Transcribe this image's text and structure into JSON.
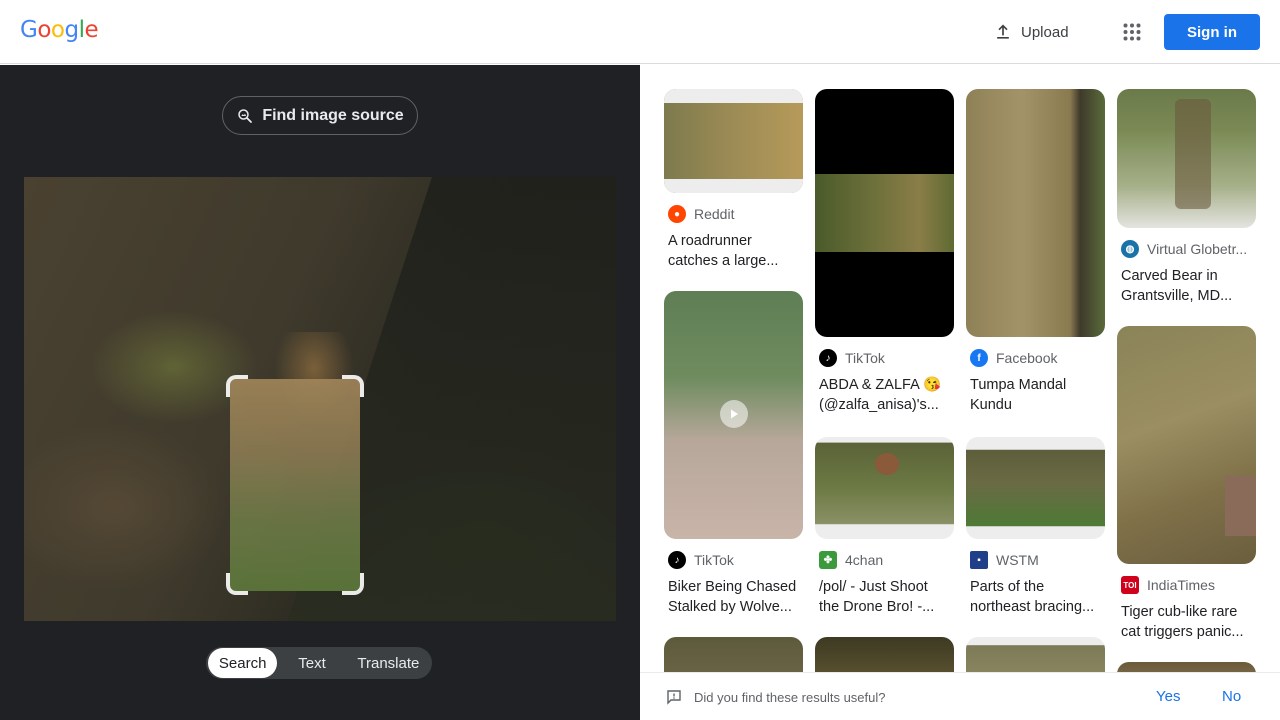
{
  "header": {
    "logo_letters": [
      "G",
      "o",
      "o",
      "g",
      "l",
      "e"
    ],
    "logo_colors": [
      "#4285F4",
      "#EA4335",
      "#FBBC05",
      "#4285F4",
      "#34A853",
      "#EA4335"
    ],
    "upload_label": "Upload",
    "apps_icon": "apps-grid-icon",
    "signin_label": "Sign in"
  },
  "left": {
    "find_source_label": "Find image source",
    "tabs": [
      {
        "label": "Search",
        "active": true
      },
      {
        "label": "Text",
        "active": false
      },
      {
        "label": "Translate",
        "active": false
      }
    ]
  },
  "results": [
    {
      "source": "Reddit",
      "icon": "reddit-icon",
      "icon_color": "#FF4500",
      "title_lines": [
        "A roadrunner",
        "catches a large..."
      ]
    },
    {
      "source": "TikTok",
      "icon": "tiktok-icon",
      "icon_color": "#000000",
      "title_lines": [
        "ABDA & ZALFA 😘",
        "(@zalfa_anisa)'s..."
      ]
    },
    {
      "source": "Facebook",
      "icon": "facebook-icon",
      "icon_color": "#1877F2",
      "title_lines": [
        "Tumpa Mandal",
        "Kundu"
      ]
    },
    {
      "source": "Virtual Globetr...",
      "icon": "globe-icon",
      "icon_color": "#1a73a8",
      "title_lines": [
        "Carved Bear in",
        "Grantsville, MD..."
      ]
    },
    {
      "source": "TikTok",
      "icon": "tiktok-icon",
      "icon_color": "#000000",
      "title_lines": [
        "Biker Being Chased",
        "Stalked by Wolve..."
      ]
    },
    {
      "source": "4chan",
      "icon": "4chan-icon",
      "icon_color": "#3b9a3b",
      "title_lines": [
        "/pol/ - Just Shoot",
        "the Drone Bro! -..."
      ]
    },
    {
      "source": "WSTM",
      "icon": "wstm-icon",
      "icon_color": "#1f3f8a",
      "title_lines": [
        "Parts of the",
        "northeast bracing..."
      ]
    },
    {
      "source": "IndiaTimes",
      "icon": "indiatimes-icon",
      "icon_color": "#d0021b",
      "title_lines": [
        "Tiger cub-like rare",
        "cat triggers panic..."
      ]
    }
  ],
  "feedback": {
    "question": "Did you find these results useful?",
    "yes": "Yes",
    "no": "No"
  }
}
